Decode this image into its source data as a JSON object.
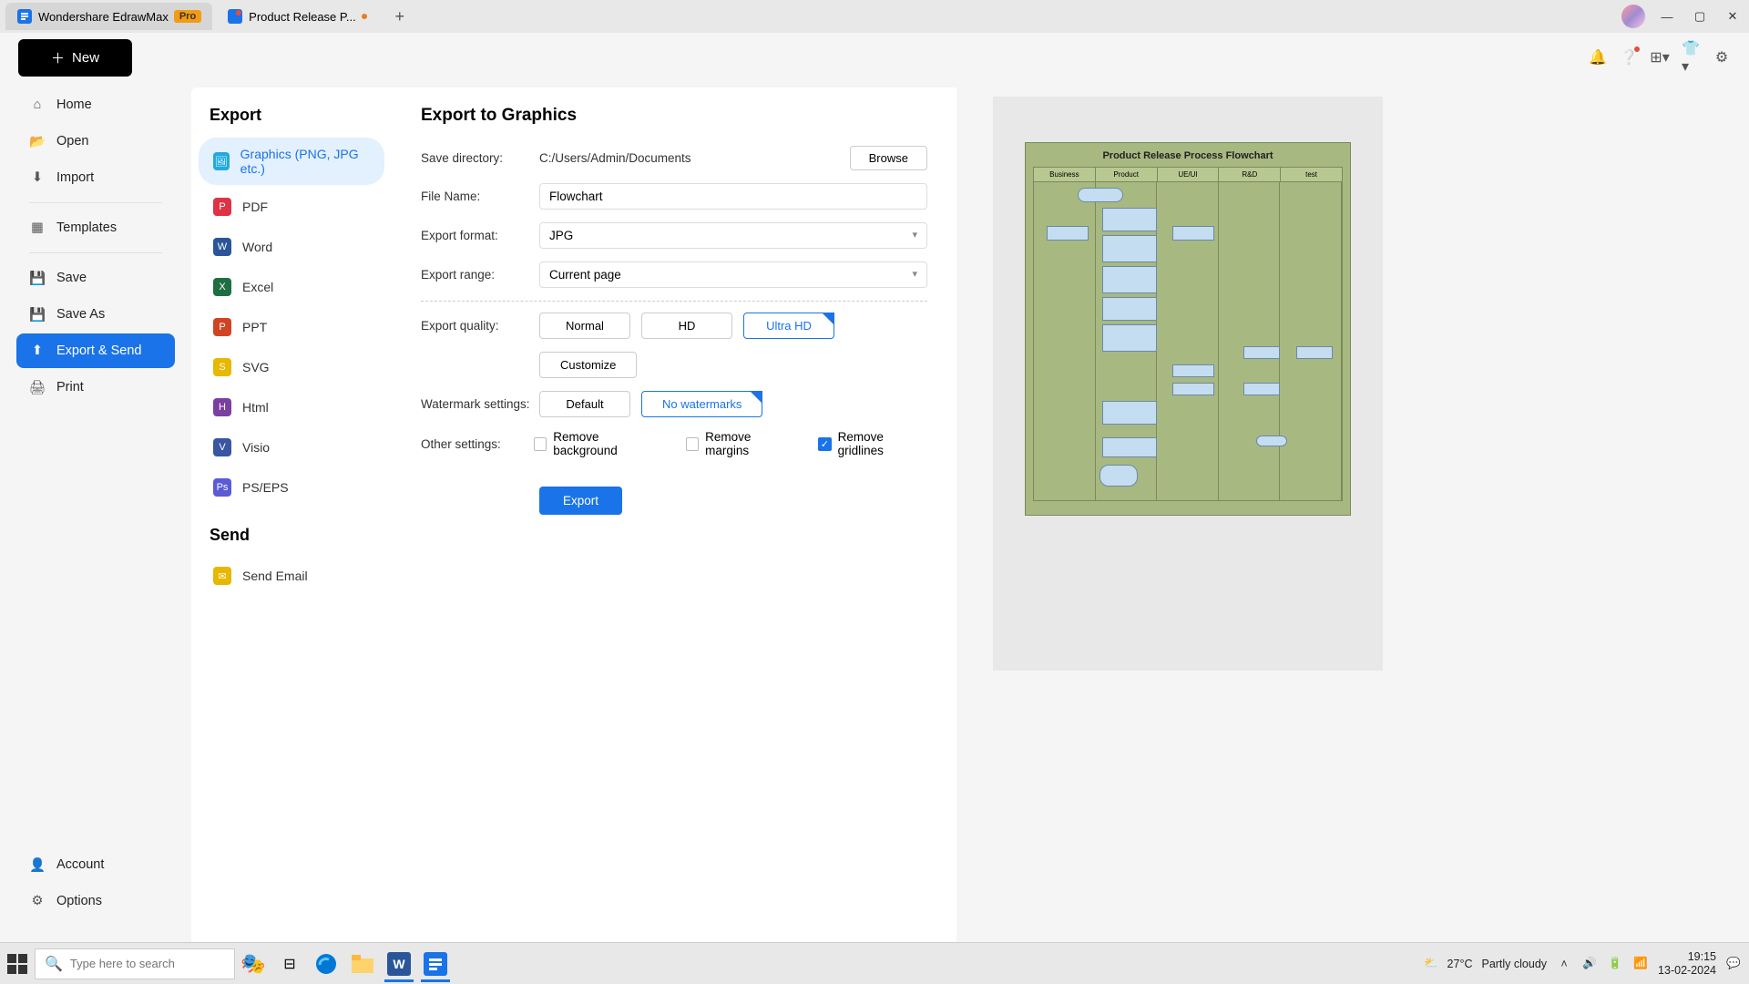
{
  "titlebar": {
    "tab1_name": "Wondershare EdrawMax",
    "tab1_badge": "Pro",
    "tab2_name": "Product Release P..."
  },
  "toolbar": {
    "new_label": "New"
  },
  "nav": {
    "home": "Home",
    "open": "Open",
    "import": "Import",
    "templates": "Templates",
    "save": "Save",
    "saveas": "Save As",
    "exportsend": "Export & Send",
    "print": "Print",
    "account": "Account",
    "options": "Options"
  },
  "export_panel": {
    "title": "Export",
    "graphics": "Graphics (PNG, JPG etc.)",
    "pdf": "PDF",
    "word": "Word",
    "excel": "Excel",
    "ppt": "PPT",
    "svg": "SVG",
    "html": "Html",
    "visio": "Visio",
    "pseps": "PS/EPS",
    "send_title": "Send",
    "send_email": "Send Email"
  },
  "settings": {
    "title": "Export to Graphics",
    "save_dir_label": "Save directory:",
    "save_dir_value": "C:/Users/Admin/Documents",
    "browse": "Browse",
    "filename_label": "File Name:",
    "filename_value": "Flowchart",
    "format_label": "Export format:",
    "format_value": "JPG",
    "range_label": "Export range:",
    "range_value": "Current page",
    "quality_label": "Export quality:",
    "quality_normal": "Normal",
    "quality_hd": "HD",
    "quality_ultra": "Ultra HD",
    "customize": "Customize",
    "watermark_label": "Watermark settings:",
    "watermark_default": "Default",
    "watermark_none": "No watermarks",
    "other_label": "Other settings:",
    "remove_bg": "Remove background",
    "remove_margins": "Remove margins",
    "remove_gridlines": "Remove gridlines",
    "export_btn": "Export"
  },
  "preview": {
    "chart_title": "Product Release Process Flowchart",
    "cols": [
      "Business",
      "Product",
      "UE/UI",
      "R&D",
      "test"
    ]
  },
  "taskbar": {
    "search_placeholder": "Type here to search",
    "weather_temp": "27°C",
    "weather_desc": "Partly cloudy",
    "time": "19:15",
    "date": "13-02-2024"
  }
}
